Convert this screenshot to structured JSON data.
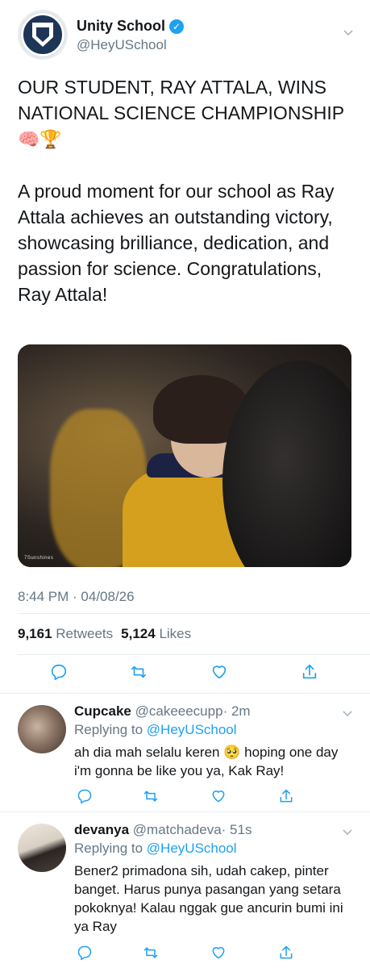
{
  "tweet": {
    "display_name": "Unity School",
    "handle": "@HeyUSchool",
    "headline": "OUR STUDENT, RAY ATTALA, WINS NATIONAL SCIENCE CHAMPIONSHIP",
    "headline_emojis": "🧠🏆",
    "body": "A proud moment for our school as Ray Attala achieves an outstanding victory, showcasing brilliance, dedication, and passion for science. Congratulations, Ray Attala!",
    "timestamp": "8:44 PM · 04/08/26",
    "retweets_count": "9,161",
    "retweets_label": "Retweets",
    "likes_count": "5,124",
    "likes_label": "Likes",
    "image_watermark": "7Sunshines"
  },
  "actions": {
    "reply_icon": "reply-icon",
    "retweet_icon": "retweet-icon",
    "like_icon": "heart-icon",
    "share_icon": "share-icon"
  },
  "replies": [
    {
      "name": "Cupcake",
      "handle": "@cakeeecupp",
      "time": "· 2m",
      "replying_prefix": "Replying to",
      "replying_to": "@HeyUSchool",
      "text": "ah dia mah selalu keren 🥺 hoping one day i'm gonna be like you ya, Kak Ray!"
    },
    {
      "name": "devanya",
      "handle": "@matchadeva",
      "time": "· 51s",
      "replying_prefix": "Replying to",
      "replying_to": "@HeyUSchool",
      "text": "Bener2 primadona sih, udah cakep, pinter banget. Harus punya pasangan yang setara pokoknya! Kalau nggak gue ancurin bumi ini ya Ray"
    }
  ],
  "colors": {
    "accent": "#1da1f2",
    "secondary_text": "#657786",
    "primary_text": "#14171a",
    "divider": "#e6ecf0"
  }
}
